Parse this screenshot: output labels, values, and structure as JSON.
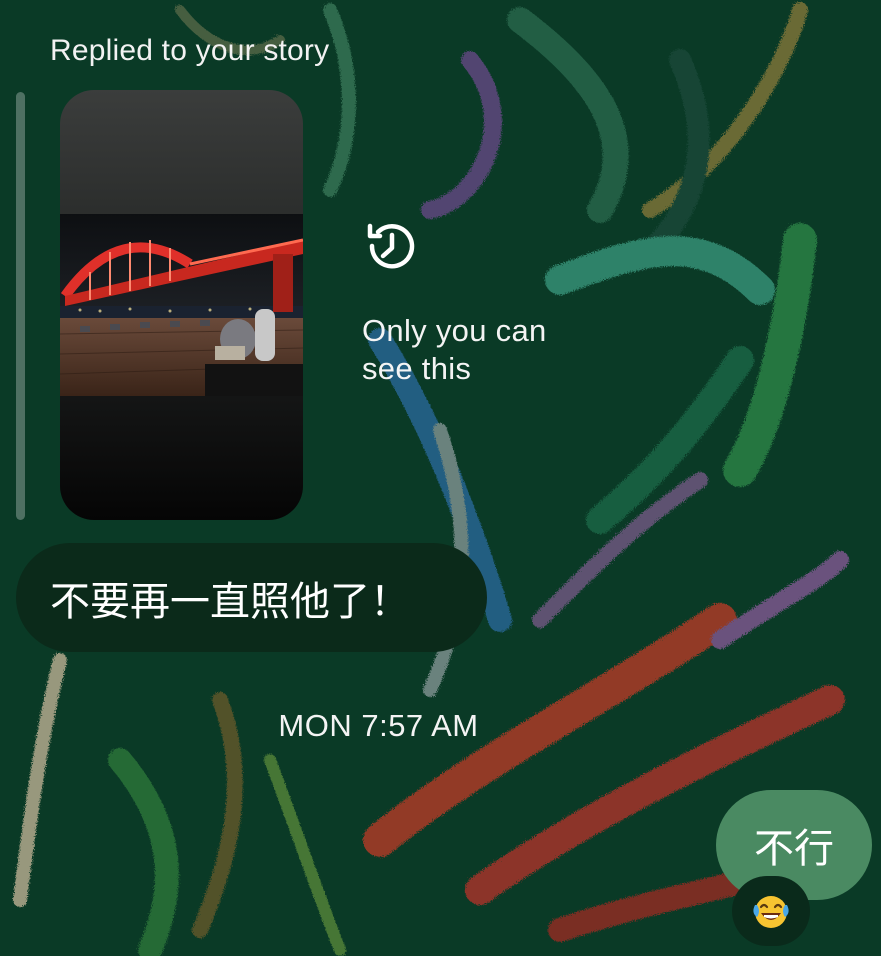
{
  "story_reply": {
    "caption": "Replied to your story",
    "privacy_note": "Only you can see this",
    "icon": "history-icon"
  },
  "messages": [
    {
      "direction": "incoming",
      "text": "不要再一直照他了！"
    },
    {
      "direction": "outgoing",
      "text": "不行",
      "reaction": "laughing-tears-emoji"
    }
  ],
  "timestamp": "MON 7:57 AM",
  "colors": {
    "background": "#0a3a26",
    "incoming_bubble": "#0b2a1a",
    "outgoing_bubble": "#4a8a62"
  }
}
